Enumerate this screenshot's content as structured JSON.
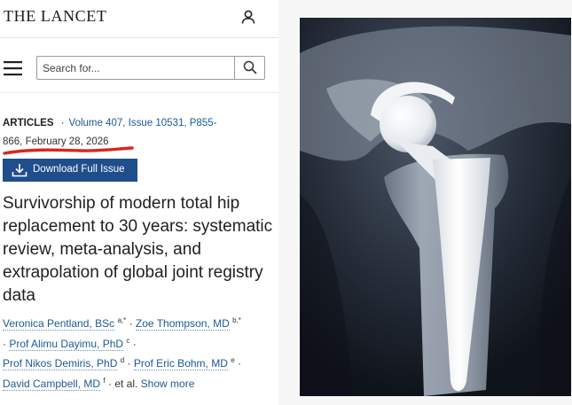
{
  "header": {
    "logo": "THE LANCET",
    "user_icon": "user-icon"
  },
  "search": {
    "placeholder": "Search for...",
    "button_icon": "search-icon",
    "menu_icon": "hamburger-menu-icon"
  },
  "meta": {
    "type": "ARTICLES",
    "separator": "·",
    "volume": "Volume 407, Issue 10531, P855-",
    "pages_cont": "866, February 28, 2026"
  },
  "download": {
    "label": "Download Full Issue",
    "icon": "download-icon"
  },
  "article": {
    "title": "Survivorship of modern total hip replacement to 30 years: systematic review, meta-analysis, and extrapolation of global joint registry data"
  },
  "authors": [
    {
      "name": "Veronica Pentland, BSc",
      "sup": "a,*"
    },
    {
      "name": "Zoe Thompson, MD",
      "sup": "b,*"
    },
    {
      "name": "Prof Alimu Dayimu, PhD",
      "sup": "c"
    },
    {
      "name": "Prof Nikos Demiris, PhD",
      "sup": "d"
    },
    {
      "name": "Prof Eric Bohm, MD",
      "sup": "e"
    },
    {
      "name": "David Campbell, MD",
      "sup": "f"
    }
  ],
  "authors_suffix": "et al.",
  "show_more": "Show more",
  "image": {
    "subject": "hip-replacement-xray"
  },
  "colors": {
    "brand_blue": "#1f4e8c",
    "link_blue": "#1a5a96",
    "annotation_red": "#d9261c"
  }
}
